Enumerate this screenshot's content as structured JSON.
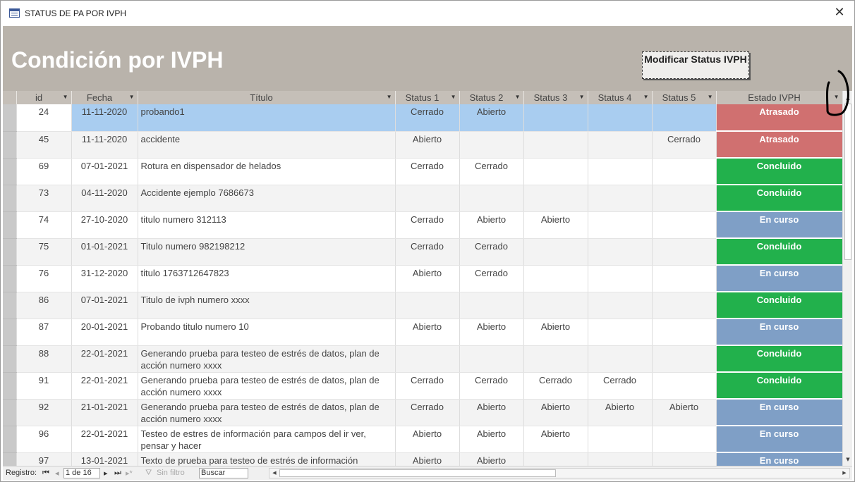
{
  "window": {
    "title": "STATUS DE PA POR IVPH",
    "close_glyph": "✕"
  },
  "header": {
    "title": "Condición por IVPH",
    "modify_button": "Modificar Status IVPH"
  },
  "columns": [
    {
      "label": "id"
    },
    {
      "label": "Fecha"
    },
    {
      "label": "Título"
    },
    {
      "label": "Status 1"
    },
    {
      "label": "Status 2"
    },
    {
      "label": "Status 3"
    },
    {
      "label": "Status 4"
    },
    {
      "label": "Status 5"
    },
    {
      "label": "Estado IVPH"
    }
  ],
  "estado_colors": {
    "Atrasado": "#d07070",
    "Concluido": "#22b14c",
    "En curso": "#7f9fc6"
  },
  "rows": [
    {
      "id": "24",
      "fecha": "11-11-2020",
      "titulo": "probando1",
      "s1": "Cerrado",
      "s2": "Abierto",
      "s3": "",
      "s4": "",
      "s5": "",
      "estado": "Atrasado",
      "selected": true
    },
    {
      "id": "45",
      "fecha": "11-11-2020",
      "titulo": "accidente",
      "s1": "Abierto",
      "s2": "",
      "s3": "",
      "s4": "",
      "s5": "Cerrado",
      "estado": "Atrasado"
    },
    {
      "id": "69",
      "fecha": "07-01-2021",
      "titulo": "Rotura en dispensador de helados",
      "s1": "Cerrado",
      "s2": "Cerrado",
      "s3": "",
      "s4": "",
      "s5": "",
      "estado": "Concluido"
    },
    {
      "id": "73",
      "fecha": "04-11-2020",
      "titulo": "Accidente ejemplo 7686673",
      "s1": "",
      "s2": "",
      "s3": "",
      "s4": "",
      "s5": "",
      "estado": "Concluido"
    },
    {
      "id": "74",
      "fecha": "27-10-2020",
      "titulo": "titulo numero 312113",
      "s1": "Cerrado",
      "s2": "Abierto",
      "s3": "Abierto",
      "s4": "",
      "s5": "",
      "estado": "En curso"
    },
    {
      "id": "75",
      "fecha": "01-01-2021",
      "titulo": "Titulo numero 982198212",
      "s1": "Cerrado",
      "s2": "Cerrado",
      "s3": "",
      "s4": "",
      "s5": "",
      "estado": "Concluido"
    },
    {
      "id": "76",
      "fecha": "31-12-2020",
      "titulo": "titulo 1763712647823",
      "s1": "Abierto",
      "s2": "Cerrado",
      "s3": "",
      "s4": "",
      "s5": "",
      "estado": "En curso"
    },
    {
      "id": "86",
      "fecha": "07-01-2021",
      "titulo": "Titulo de ivph numero xxxx",
      "s1": "",
      "s2": "",
      "s3": "",
      "s4": "",
      "s5": "",
      "estado": "Concluido"
    },
    {
      "id": "87",
      "fecha": "20-01-2021",
      "titulo": "Probando titulo numero 10",
      "s1": "Abierto",
      "s2": "Abierto",
      "s3": "Abierto",
      "s4": "",
      "s5": "",
      "estado": "En curso"
    },
    {
      "id": "88",
      "fecha": "22-01-2021",
      "titulo": "Generando prueba para testeo de estrés de datos, plan de acción numero xxxx",
      "s1": "",
      "s2": "",
      "s3": "",
      "s4": "",
      "s5": "",
      "estado": "Concluido"
    },
    {
      "id": "91",
      "fecha": "22-01-2021",
      "titulo": "Generando prueba para testeo de estrés de datos, plan de acción numero xxxx",
      "s1": "Cerrado",
      "s2": "Cerrado",
      "s3": "Cerrado",
      "s4": "Cerrado",
      "s5": "",
      "estado": "Concluido"
    },
    {
      "id": "92",
      "fecha": "21-01-2021",
      "titulo": "Generando prueba para testeo de estrés de datos, plan de acción numero xxxx",
      "s1": "Cerrado",
      "s2": "Abierto",
      "s3": "Abierto",
      "s4": "Abierto",
      "s5": "Abierto",
      "estado": "En curso"
    },
    {
      "id": "96",
      "fecha": "22-01-2021",
      "titulo": "Testeo de estres de información para campos del ir ver, pensar y hacer",
      "s1": "Abierto",
      "s2": "Abierto",
      "s3": "Abierto",
      "s4": "",
      "s5": "",
      "estado": "En curso"
    },
    {
      "id": "97",
      "fecha": "13-01-2021",
      "titulo": "Texto de prueba para testeo de estrés de información",
      "s1": "Abierto",
      "s2": "Abierto",
      "s3": "",
      "s4": "",
      "s5": "",
      "estado": "En curso"
    }
  ],
  "navbar": {
    "registro_label": "Registro:",
    "first": "⏮",
    "prev": "◂",
    "position": "1 de 16",
    "next": "▸",
    "last": "⏭",
    "new": "▸*",
    "filter_label": "Sin filtro",
    "search": "Buscar"
  }
}
